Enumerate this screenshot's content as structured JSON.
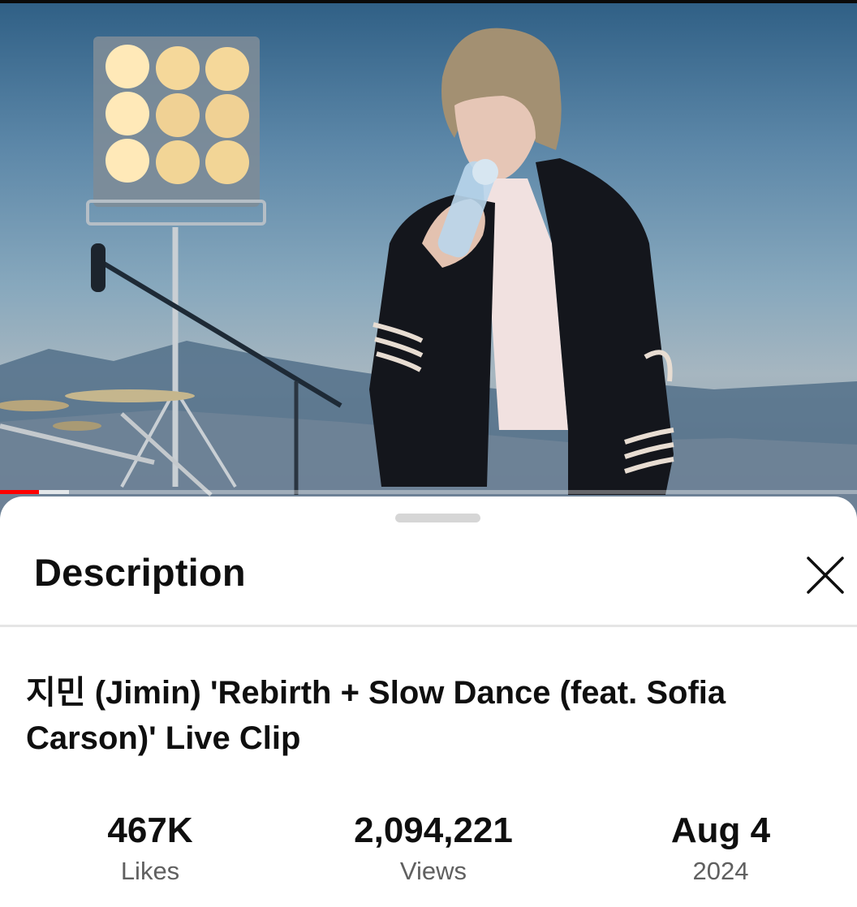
{
  "description_sheet": {
    "title": "Description",
    "close_icon": "close-icon",
    "video_title": "지민 (Jimin) 'Rebirth + Slow Dance (feat. Sofia Carson)' Live Clip",
    "stats": {
      "likes": {
        "value": "467K",
        "label": "Likes"
      },
      "views": {
        "value": "2,094,221",
        "label": "Views"
      },
      "date": {
        "value": "Aug 4",
        "label": "2024"
      }
    }
  },
  "player": {
    "progress_played_fraction": 0.045,
    "progress_buffered_fraction": 0.08,
    "progress_color": "#ff0000"
  },
  "colors": {
    "text_primary": "#0f0f0f",
    "text_secondary": "#606060",
    "divider": "#e5e5e5",
    "handle": "#d6d6d6"
  }
}
